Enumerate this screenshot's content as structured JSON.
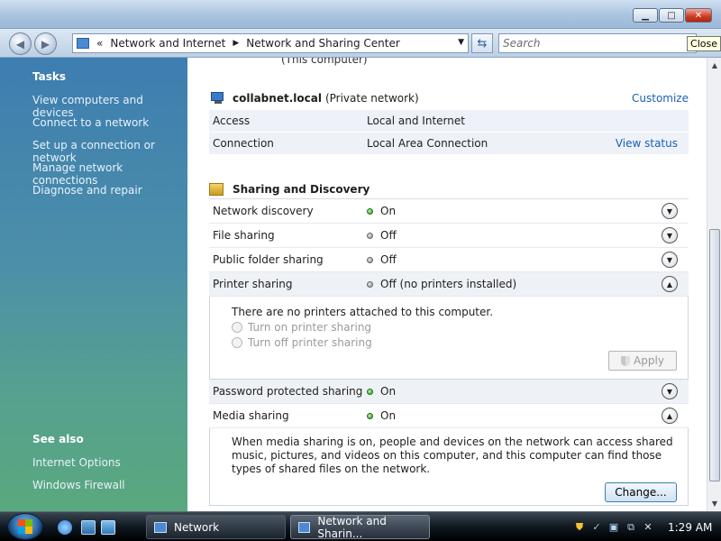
{
  "window": {
    "minimize": "▁",
    "maximize": "□",
    "close": "✕",
    "close_tooltip": "Close"
  },
  "address": {
    "prefix": "«",
    "crumbs": [
      "Network and Internet",
      "Network and Sharing Center"
    ],
    "separator": "▶",
    "search_placeholder": "Search"
  },
  "sidebar": {
    "tasks_heading": "Tasks",
    "tasks": [
      "View computers and devices",
      "Connect to a network",
      "Set up a connection or network",
      "Manage network connections",
      "Diagnose and repair"
    ],
    "see_also_heading": "See also",
    "see_also": [
      "Internet Options",
      "Windows Firewall"
    ]
  },
  "main": {
    "cut_text": "(This computer)",
    "network": {
      "name": "collabnet.local",
      "type": "(Private network)",
      "customize": "Customize",
      "rows": [
        {
          "label": "Access",
          "value": "Local and Internet",
          "link": ""
        },
        {
          "label": "Connection",
          "value": "Local Area Connection",
          "link": "View status"
        }
      ]
    },
    "sharing": {
      "heading": "Sharing and Discovery",
      "items": [
        {
          "label": "Network discovery",
          "status": "On",
          "state": "on",
          "expanded": false
        },
        {
          "label": "File sharing",
          "status": "Off",
          "state": "off",
          "expanded": false
        },
        {
          "label": "Public folder sharing",
          "status": "Off",
          "state": "off",
          "expanded": false
        },
        {
          "label": "Printer sharing",
          "status": "Off (no printers installed)",
          "state": "off",
          "expanded": true
        },
        {
          "label": "Password protected sharing",
          "status": "On",
          "state": "on",
          "expanded": false
        },
        {
          "label": "Media sharing",
          "status": "On",
          "state": "on",
          "expanded": true
        }
      ],
      "printer_panel": {
        "text": "There are no printers attached to this computer.",
        "option_on": "Turn on printer sharing",
        "option_off": "Turn off printer sharing",
        "apply": "Apply"
      },
      "media_panel": {
        "text": "When media sharing is on, people and devices on the network can access shared music, pictures, and videos on this computer, and this computer can find those types of shared files on the network.",
        "change": "Change..."
      }
    }
  },
  "taskbar": {
    "buttons": [
      "Network",
      "Network and Sharin..."
    ],
    "clock": "1:29 AM"
  }
}
